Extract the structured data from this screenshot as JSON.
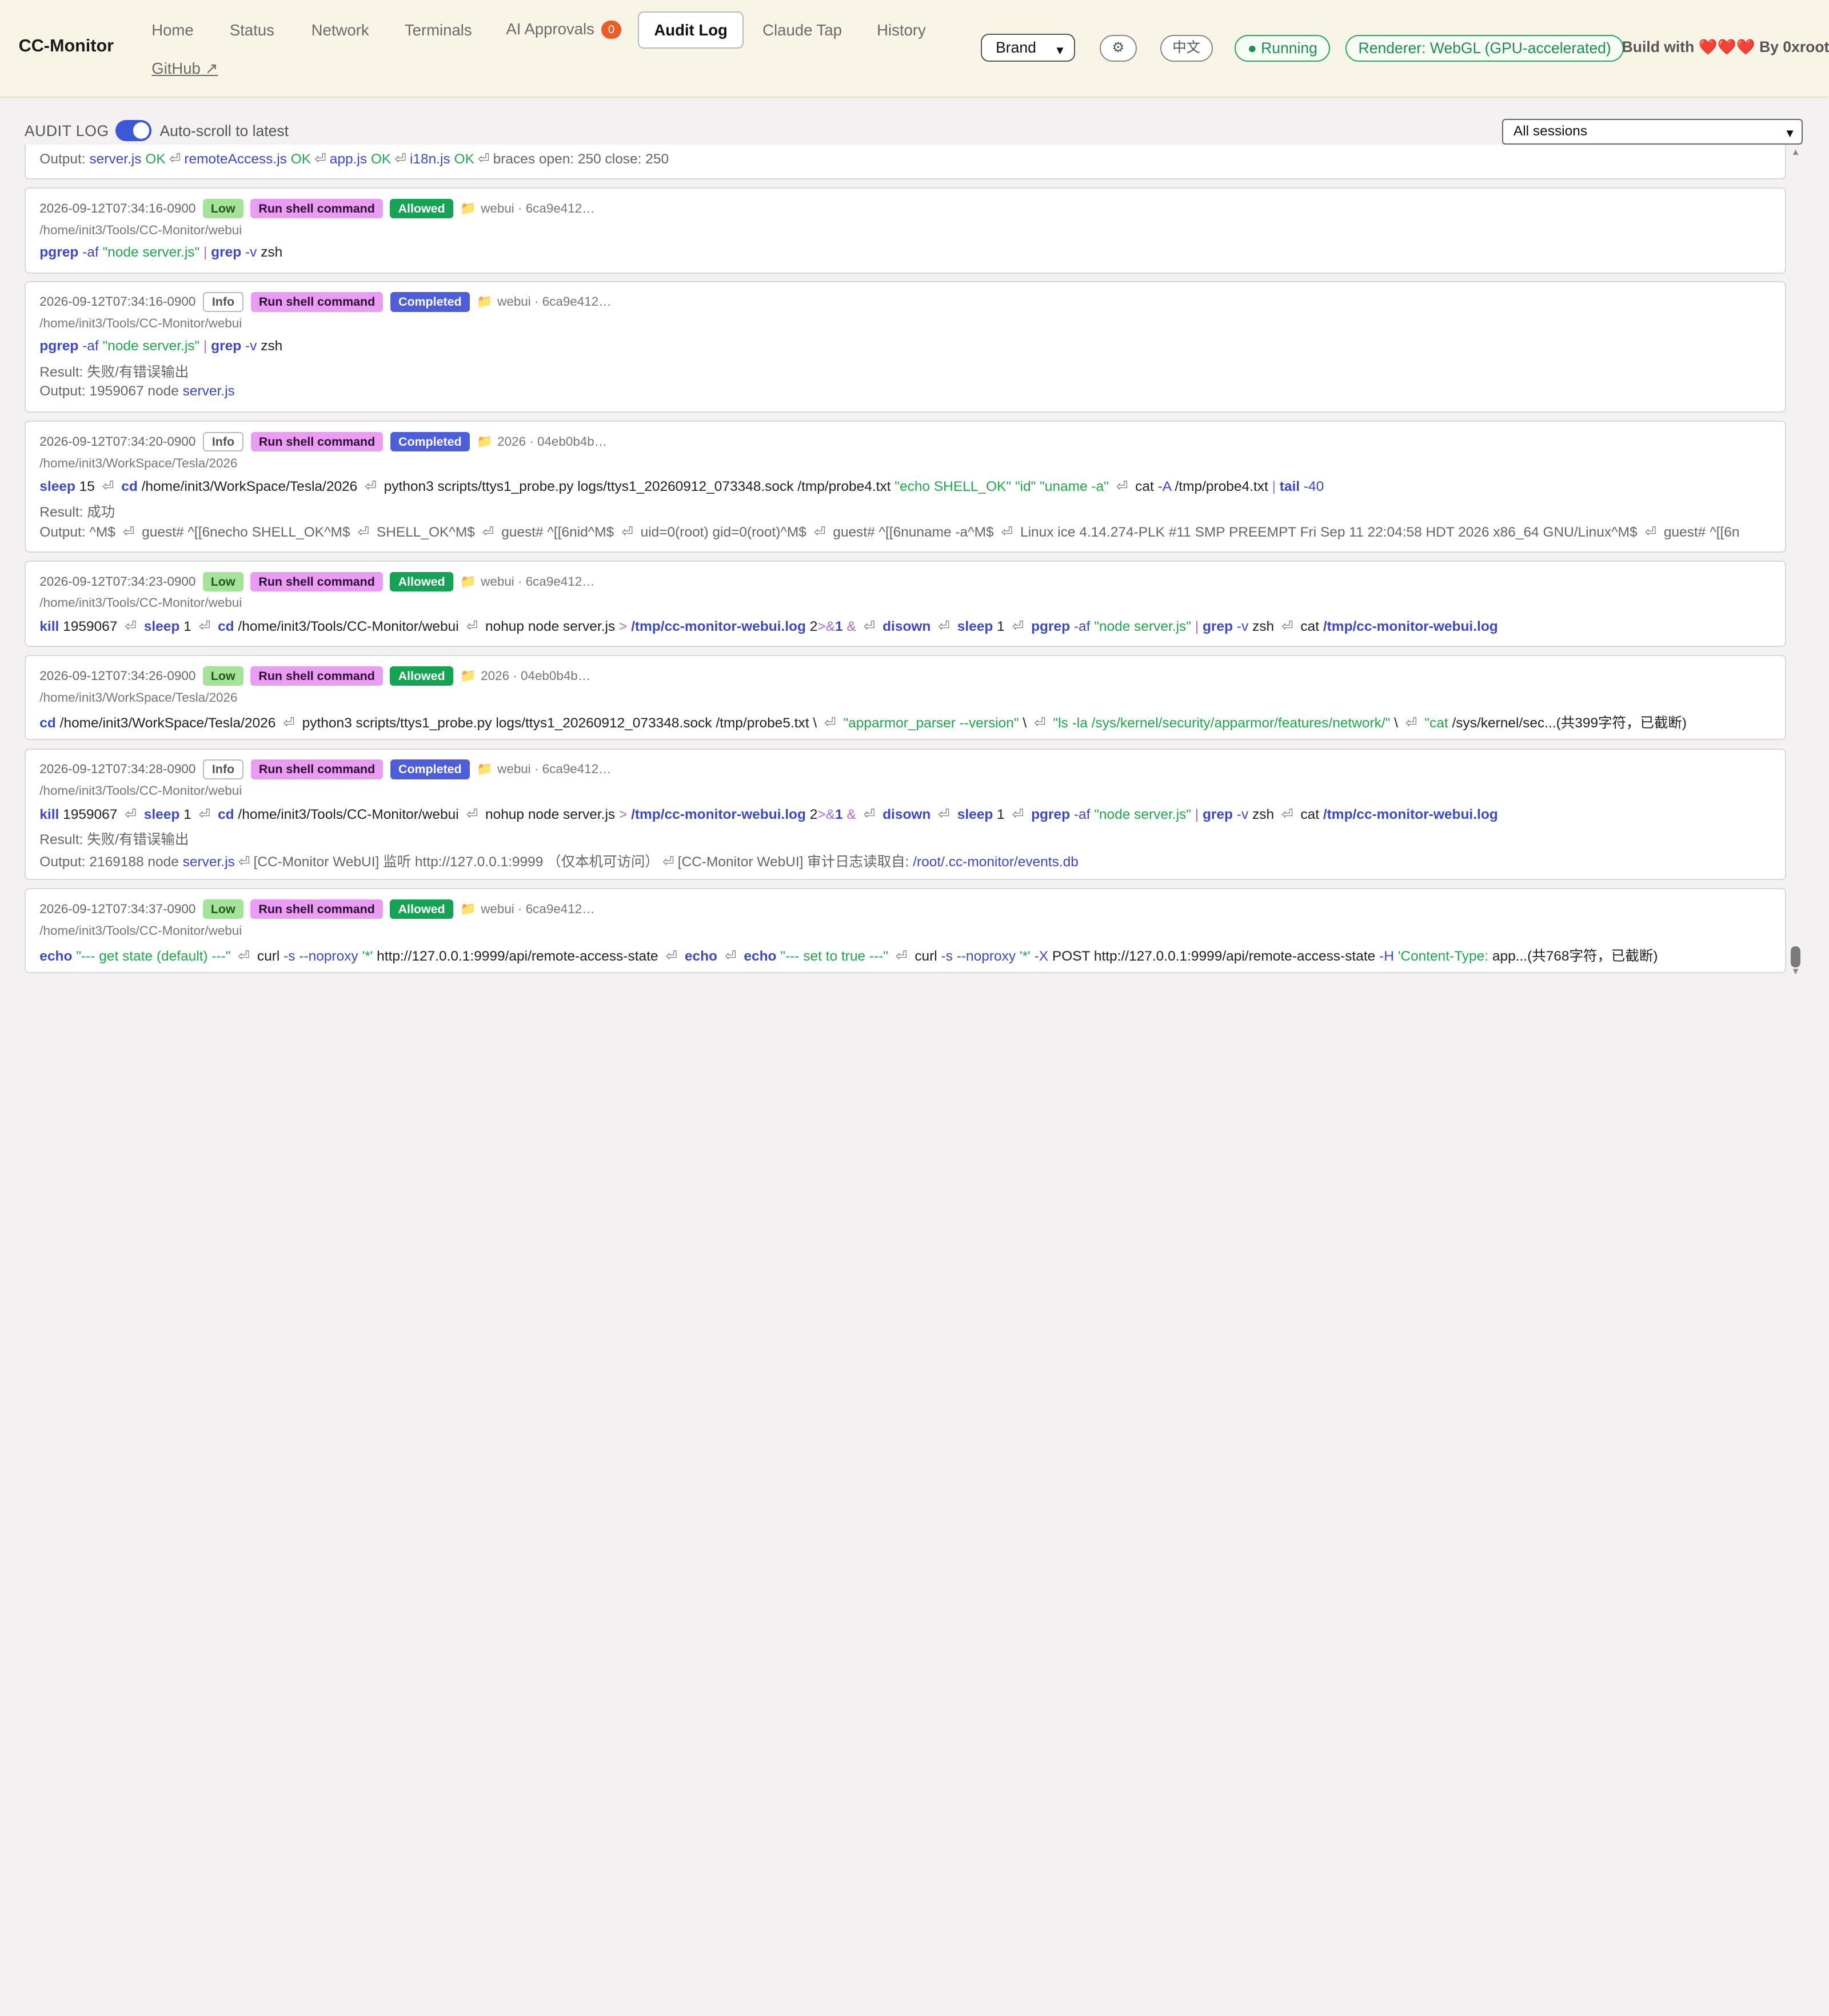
{
  "app": {
    "title": "CC-Monitor"
  },
  "nav": {
    "items": [
      {
        "label": "Home"
      },
      {
        "label": "Status"
      },
      {
        "label": "Network"
      },
      {
        "label": "Terminals"
      },
      {
        "label": "AI Approvals",
        "badge": "0"
      },
      {
        "label": "Audit Log",
        "active": true
      },
      {
        "label": "Claude Tap"
      },
      {
        "label": "History"
      }
    ],
    "github": "GitHub ↗"
  },
  "header": {
    "brand_select": "Brand",
    "settings_icon": "⚙",
    "lang_button": "中文",
    "running": "● Running",
    "renderer": "Renderer: WebGL (GPU-accelerated)",
    "build_prefix": "Build with",
    "hearts": "❤️❤️❤️",
    "build_suffix": "By 0xroot"
  },
  "audit": {
    "title": "AUDIT LOG",
    "autoscroll_label": "Auto-scroll to latest",
    "autoscroll_on": true,
    "session_filter": "All sessions",
    "result_prefix": "Result: ",
    "output_prefix": "Output: ",
    "return_symbol": "⏎"
  },
  "entries": [
    {
      "timestamp": "",
      "level": "",
      "action": "",
      "result": "",
      "project": "",
      "path": "",
      "output_parts": [
        "server.js",
        "OK",
        "remoteAccess.js",
        "OK",
        "app.js",
        "OK",
        "i18n.js",
        "OK",
        "braces open: 250 close: 250"
      ]
    },
    {
      "timestamp": "2026-09-12T07:34:16-0900",
      "level": "Low",
      "action": "Run shell command",
      "result": "Allowed",
      "project": "webui · 6ca9e412…",
      "path": "/home/init3/Tools/CC-Monitor/webui",
      "command": "pgrep -af \"node server.js\" | grep -v zsh"
    },
    {
      "timestamp": "2026-09-12T07:34:16-0900",
      "level": "Info",
      "action": "Run shell command",
      "result": "Completed",
      "project": "webui · 6ca9e412…",
      "path": "/home/init3/Tools/CC-Monitor/webui",
      "command": "pgrep -af \"node server.js\" | grep -v zsh",
      "result_text": "失败/有错误输出",
      "output_text": "1959067 node",
      "output_file": "server.js"
    },
    {
      "timestamp": "2026-09-12T07:34:20-0900",
      "level": "Info",
      "action": "Run shell command",
      "result": "Completed",
      "project": "2026 · 04eb0b4b…",
      "path": "/home/init3/WorkSpace/Tesla/2026",
      "command": "sleep 15 ⏎ cd /home/init3/WorkSpace/Tesla/2026 ⏎ python3 scripts/ttys1_probe.py logs/ttys1_20260912_073348.sock /tmp/probe4.txt \"echo SHELL_OK\" \"id\" \"uname -a\" ⏎ cat -A /tmp/probe4.txt | tail -40",
      "result_text": "成功",
      "output_text": "^M$ ⏎ guest# ^[[6necho SHELL_OK^M$ ⏎ SHELL_OK^M$ ⏎ guest# ^[[6nid^M$ ⏎ uid=0(root) gid=0(root)^M$ ⏎ guest# ^[[6nuname -a^M$ ⏎ Linux ice 4.14.274-PLK #11 SMP PREEMPT Fri Sep 11 22:04:58 HDT 2026 x86_64 GNU/Linux^M$ ⏎ guest# ^[[6n"
    },
    {
      "timestamp": "2026-09-12T07:34:23-0900",
      "level": "Low",
      "action": "Run shell command",
      "result": "Allowed",
      "project": "webui · 6ca9e412…",
      "path": "/home/init3/Tools/CC-Monitor/webui",
      "command": "kill 1959067 ⏎ sleep 1 ⏎ cd /home/init3/Tools/CC-Monitor/webui ⏎ nohup node server.js > /tmp/cc-monitor-webui.log 2>&1 & ⏎ disown ⏎ sleep 1 ⏎ pgrep -af \"node server.js\" | grep -v zsh ⏎ cat /tmp/cc-monitor-webui.log"
    },
    {
      "timestamp": "2026-09-12T07:34:26-0900",
      "level": "Low",
      "action": "Run shell command",
      "result": "Allowed",
      "project": "2026 · 04eb0b4b…",
      "path": "/home/init3/WorkSpace/Tesla/2026",
      "command": "cd /home/init3/WorkSpace/Tesla/2026 ⏎ python3 scripts/ttys1_probe.py logs/ttys1_20260912_073348.sock /tmp/probe5.txt \\ ⏎ \"apparmor_parser --version\" \\ ⏎ \"ls -la /sys/kernel/security/apparmor/features/network/\" \\ ⏎ \"cat /sys/kernel/sec...(共399字符，已截断)"
    },
    {
      "timestamp": "2026-09-12T07:34:28-0900",
      "level": "Info",
      "action": "Run shell command",
      "result": "Completed",
      "project": "webui · 6ca9e412…",
      "path": "/home/init3/Tools/CC-Monitor/webui",
      "command": "kill 1959067 ⏎ sleep 1 ⏎ cd /home/init3/Tools/CC-Monitor/webui ⏎ nohup node server.js > /tmp/cc-monitor-webui.log 2>&1 & ⏎ disown ⏎ sleep 1 ⏎ pgrep -af \"node server.js\" | grep -v zsh ⏎ cat /tmp/cc-monitor-webui.log",
      "result_text": "失败/有错误输出",
      "output_parts": [
        "2169188 node",
        "server.js",
        "[CC-Monitor WebUI] 监听 http://127.0.0.1:9999 （仅本机可访问）",
        "[CC-Monitor WebUI] 审计日志读取自:",
        "/root/.cc-monitor/events.db"
      ]
    },
    {
      "timestamp": "2026-09-12T07:34:37-0900",
      "level": "Low",
      "action": "Run shell command",
      "result": "Allowed",
      "project": "webui · 6ca9e412…",
      "path": "/home/init3/Tools/CC-Monitor/webui",
      "command": "echo \"--- get state (default) ---\" ⏎ curl -s --noproxy '*' http://127.0.0.1:9999/api/remote-access-state ⏎ echo ⏎ echo \"--- set to true ---\" ⏎ curl -s --noproxy '*' -X POST http://127.0.0.1:9999/api/remote-access-state -H 'Content-Type: app...(共768字符，已截断)"
    }
  ],
  "colors": {
    "accent": "#3c57d5",
    "allowed": "#16a356",
    "completed": "#4e5ed9",
    "low": "#a6e39a",
    "action": "#ea9cf2",
    "running": "#2aa566"
  }
}
